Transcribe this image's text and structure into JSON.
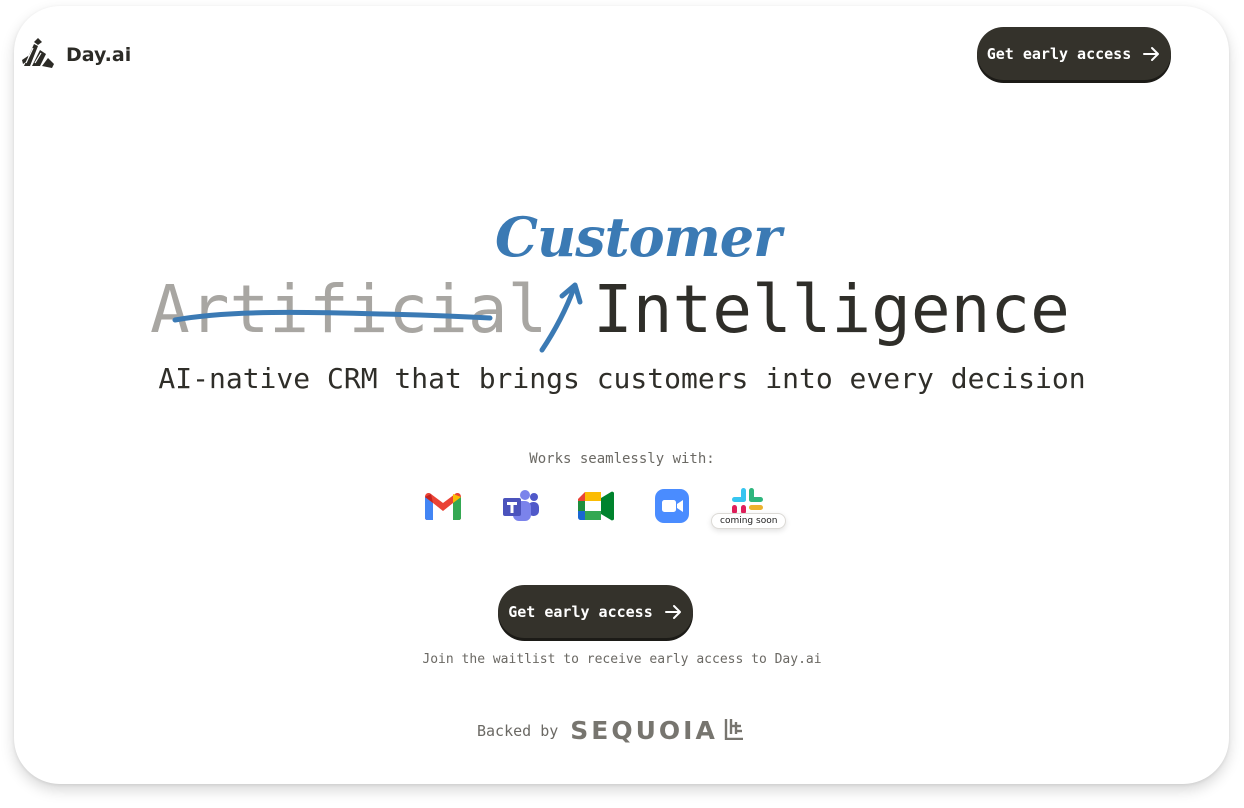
{
  "header": {
    "brand": "Day.ai",
    "cta_label": "Get early access"
  },
  "hero": {
    "struck_word": "Artificial",
    "replacement_word": "Customer",
    "main_word": "Intelligence",
    "tagline": "AI-native CRM that brings customers into every decision"
  },
  "integrations": {
    "label": "Works seamlessly with:",
    "items": [
      {
        "name": "Gmail",
        "icon": "gmail-icon"
      },
      {
        "name": "Microsoft Teams",
        "icon": "teams-icon"
      },
      {
        "name": "Google Meet",
        "icon": "google-meet-icon"
      },
      {
        "name": "Zoom",
        "icon": "zoom-icon"
      },
      {
        "name": "Slack",
        "icon": "slack-icon",
        "badge": "coming soon"
      }
    ]
  },
  "cta": {
    "label": "Get early access",
    "subtext": "Join the waitlist to receive early access to Day.ai"
  },
  "backing": {
    "label": "Backed by",
    "investor": "SEQUOIA"
  },
  "colors": {
    "button_bg": "#34322b",
    "accent_blue": "#3b7ab4",
    "text_dark": "#2f2e29",
    "text_muted": "#a8a6a2"
  }
}
